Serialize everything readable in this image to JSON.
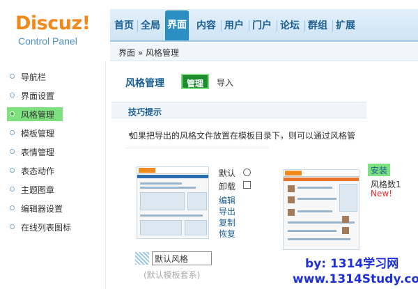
{
  "logo": {
    "name": "Discuz!",
    "subtitle": "Control Panel"
  },
  "topnav": {
    "items": [
      {
        "label": "首页",
        "active": false
      },
      {
        "label": "全局",
        "active": false
      },
      {
        "label": "界面",
        "active": true
      },
      {
        "label": "内容",
        "active": false
      },
      {
        "label": "用户",
        "active": false
      },
      {
        "label": "门户",
        "active": false
      },
      {
        "label": "论坛",
        "active": false
      },
      {
        "label": "群组",
        "active": false
      },
      {
        "label": "扩展",
        "active": false
      }
    ]
  },
  "breadcrumb": "界面 » 风格管理",
  "sidebar": {
    "items": [
      {
        "label": "导航栏",
        "active": false
      },
      {
        "label": "界面设置",
        "active": false
      },
      {
        "label": "风格管理",
        "active": true
      },
      {
        "label": "模板管理",
        "active": false
      },
      {
        "label": "表情管理",
        "active": false
      },
      {
        "label": "表态动作",
        "active": false
      },
      {
        "label": "主题图章",
        "active": false
      },
      {
        "label": "编辑器设置",
        "active": false
      },
      {
        "label": "在线列表图标",
        "active": false
      }
    ]
  },
  "main": {
    "title": "风格管理",
    "tabs": {
      "manage": "管理",
      "import": "导入"
    },
    "tips": {
      "title": "技巧提示",
      "text": "如果把导出的风格文件放置在模板目录下，则可以通过风格管"
    },
    "default_style": {
      "options": {
        "default_label": "默认",
        "uninstall_label": "卸载"
      },
      "actions": [
        "编辑",
        "导出",
        "复制",
        "恢复"
      ],
      "name_value": "默认风格",
      "subtitle": "(默认模板套系)"
    },
    "style1": {
      "install_label": "安装",
      "name": "风格数1",
      "badge": "New!"
    }
  },
  "watermark": {
    "line1": "by: 1314学习网",
    "line2": "www.1314Study.com"
  },
  "colors": {
    "accent": "#1b5f93",
    "active_green": "#7fe07f",
    "logo_orange": "#f08a1c",
    "watermark_blue": "#1e2fd8"
  }
}
